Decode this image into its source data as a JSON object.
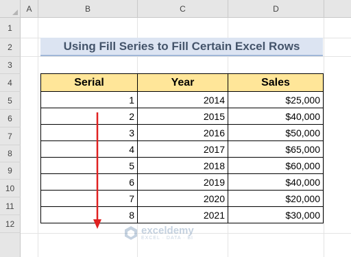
{
  "columns": [
    "A",
    "B",
    "C",
    "D"
  ],
  "rows": [
    "1",
    "2",
    "3",
    "4",
    "5",
    "6",
    "7",
    "8",
    "9",
    "10",
    "11",
    "12"
  ],
  "title": "Using Fill Series to Fill Certain Excel Rows",
  "table": {
    "headers": {
      "serial": "Serial",
      "year": "Year",
      "sales": "Sales"
    },
    "rows": [
      {
        "serial": "1",
        "year": "2014",
        "sales": "$25,000"
      },
      {
        "serial": "2",
        "year": "2015",
        "sales": "$40,000"
      },
      {
        "serial": "3",
        "year": "2016",
        "sales": "$50,000"
      },
      {
        "serial": "4",
        "year": "2017",
        "sales": "$65,000"
      },
      {
        "serial": "5",
        "year": "2018",
        "sales": "$60,000"
      },
      {
        "serial": "6",
        "year": "2019",
        "sales": "$40,000"
      },
      {
        "serial": "7",
        "year": "2020",
        "sales": "$20,000"
      },
      {
        "serial": "8",
        "year": "2021",
        "sales": "$30,000"
      }
    ]
  },
  "watermark": {
    "name": "exceldemy",
    "tagline": "EXCEL · DATA · BI"
  },
  "colors": {
    "header_fill": "#ffe699",
    "title_fill": "#dce4f2",
    "arrow": "#e02020"
  }
}
